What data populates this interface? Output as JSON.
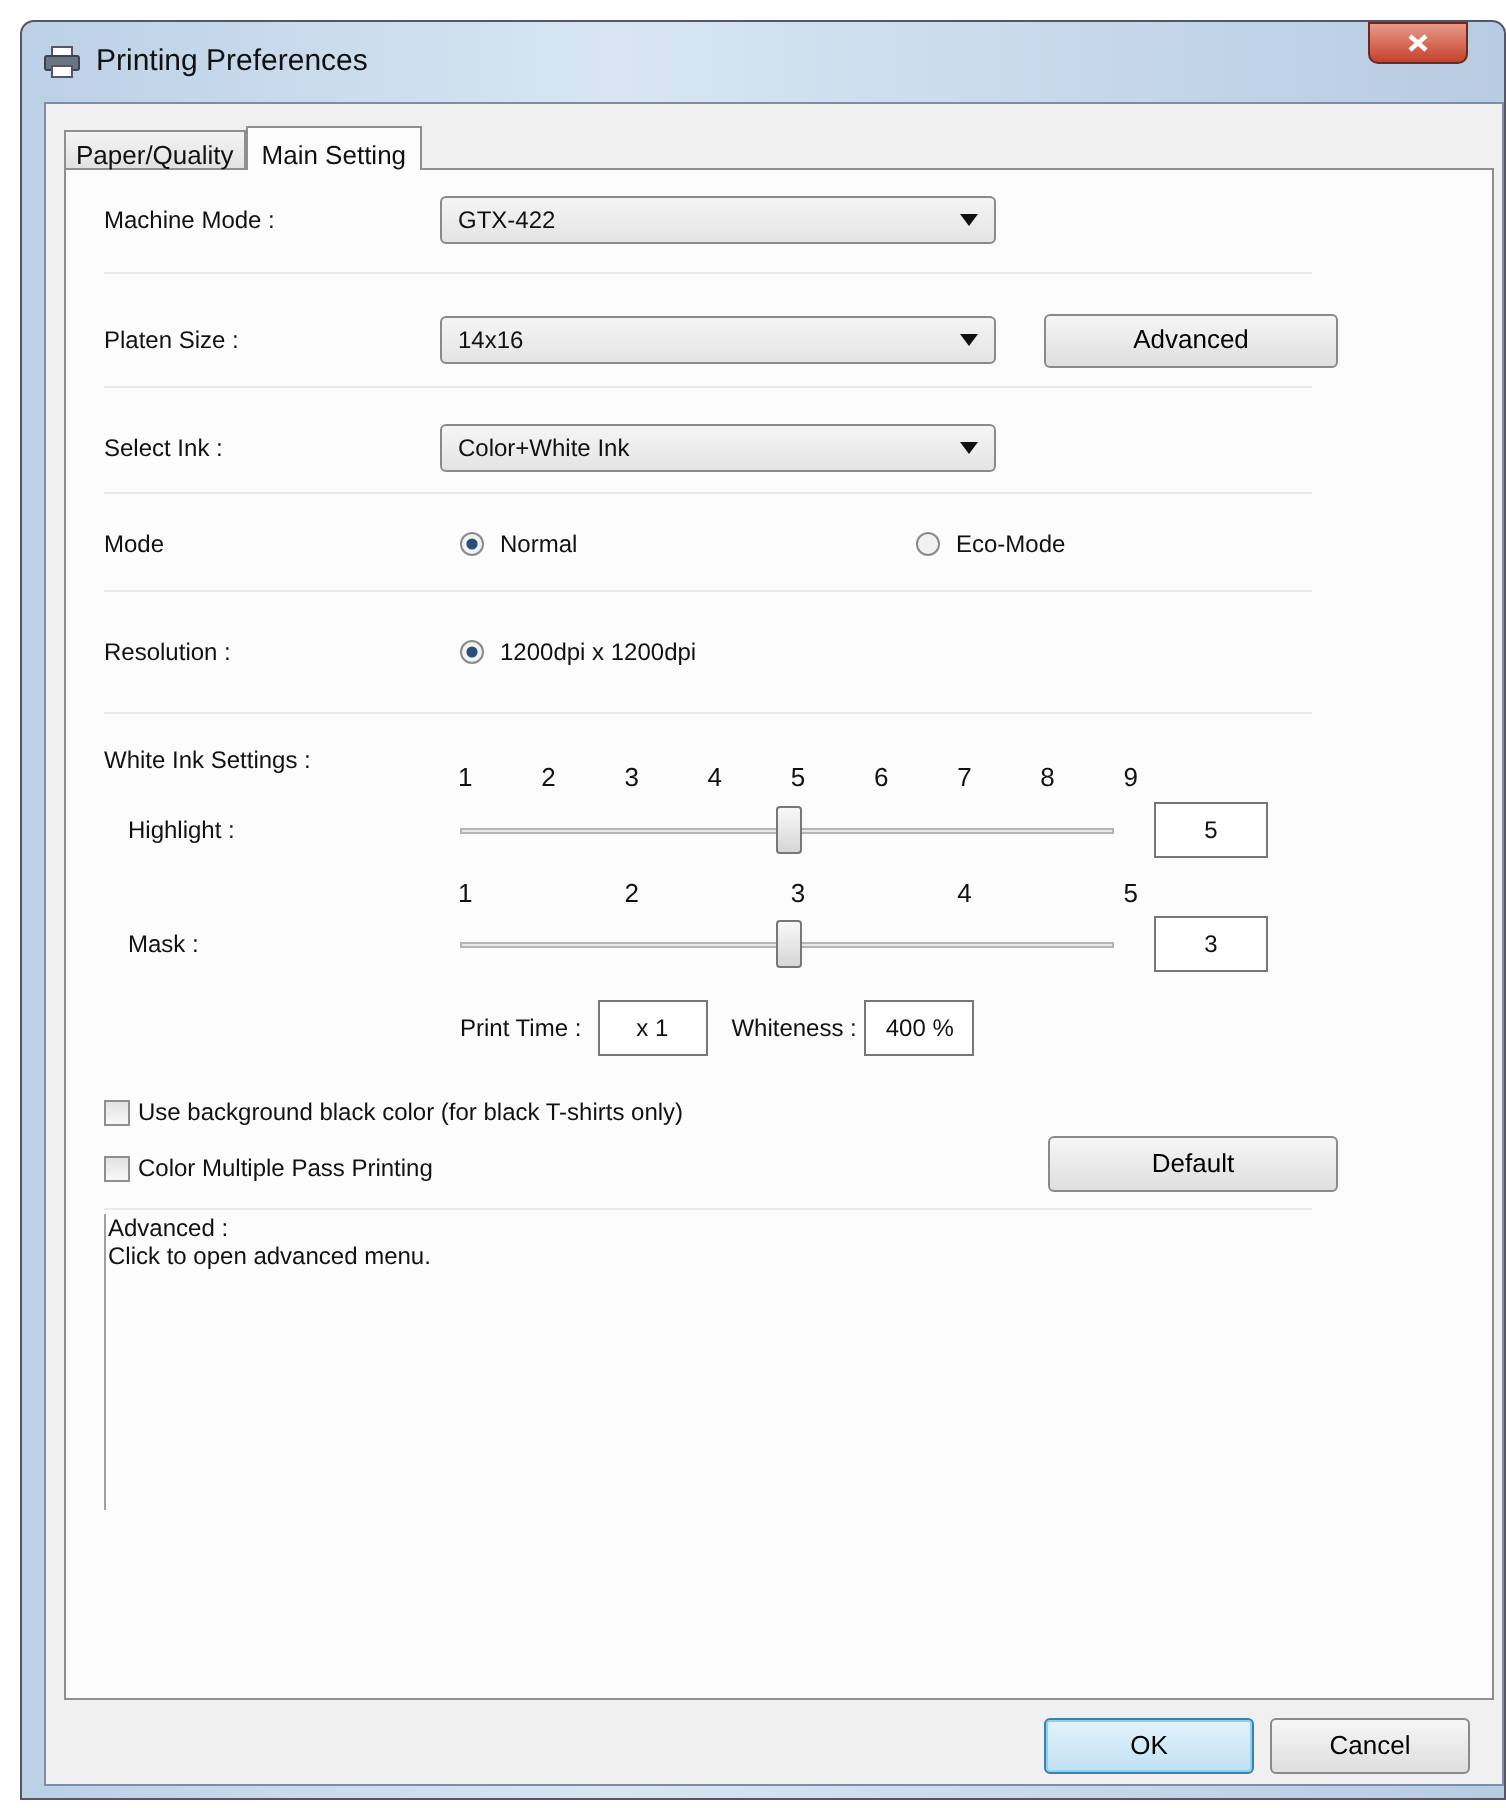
{
  "window": {
    "title": "Printing Preferences"
  },
  "tabs": [
    {
      "label": "Paper/Quality",
      "selected": false
    },
    {
      "label": "Main Setting",
      "selected": true
    }
  ],
  "machine_mode": {
    "label": "Machine Mode :",
    "value": "GTX-422"
  },
  "platen_size": {
    "label": "Platen Size :",
    "value": "14x16",
    "button": "Advanced"
  },
  "select_ink": {
    "label": "Select Ink :",
    "value": "Color+White Ink"
  },
  "mode": {
    "label": "Mode",
    "options": [
      {
        "label": "Normal",
        "selected": true
      },
      {
        "label": "Eco-Mode",
        "selected": false
      }
    ]
  },
  "resolution": {
    "label": "Resolution :",
    "options": [
      {
        "label": "1200dpi x 1200dpi",
        "selected": true
      }
    ]
  },
  "white_ink": {
    "label": "White Ink Settings :",
    "sliders": [
      {
        "label": "Highlight :",
        "ticks": [
          "1",
          "2",
          "3",
          "4",
          "5",
          "6",
          "7",
          "8",
          "9"
        ],
        "level": 0.5,
        "value": "5"
      },
      {
        "label": "Mask :",
        "ticks": [
          "1",
          "2",
          "3",
          "4",
          "5"
        ],
        "level": 0.5,
        "value": "3"
      }
    ],
    "print_time": {
      "label": "Print Time :",
      "value": "x 1"
    },
    "whiteness": {
      "label": "Whiteness :",
      "value": "400 %"
    }
  },
  "checkboxes": [
    {
      "label": "Use background black color (for black T-shirts only)",
      "checked": false
    },
    {
      "label": "Color Multiple Pass Printing",
      "checked": false
    }
  ],
  "default_button": "Default",
  "info": {
    "title": "Advanced :",
    "text": "Click to open advanced menu."
  },
  "buttons": [
    {
      "label": "OK",
      "kind": "default"
    },
    {
      "label": "Cancel",
      "kind": "normal"
    }
  ]
}
